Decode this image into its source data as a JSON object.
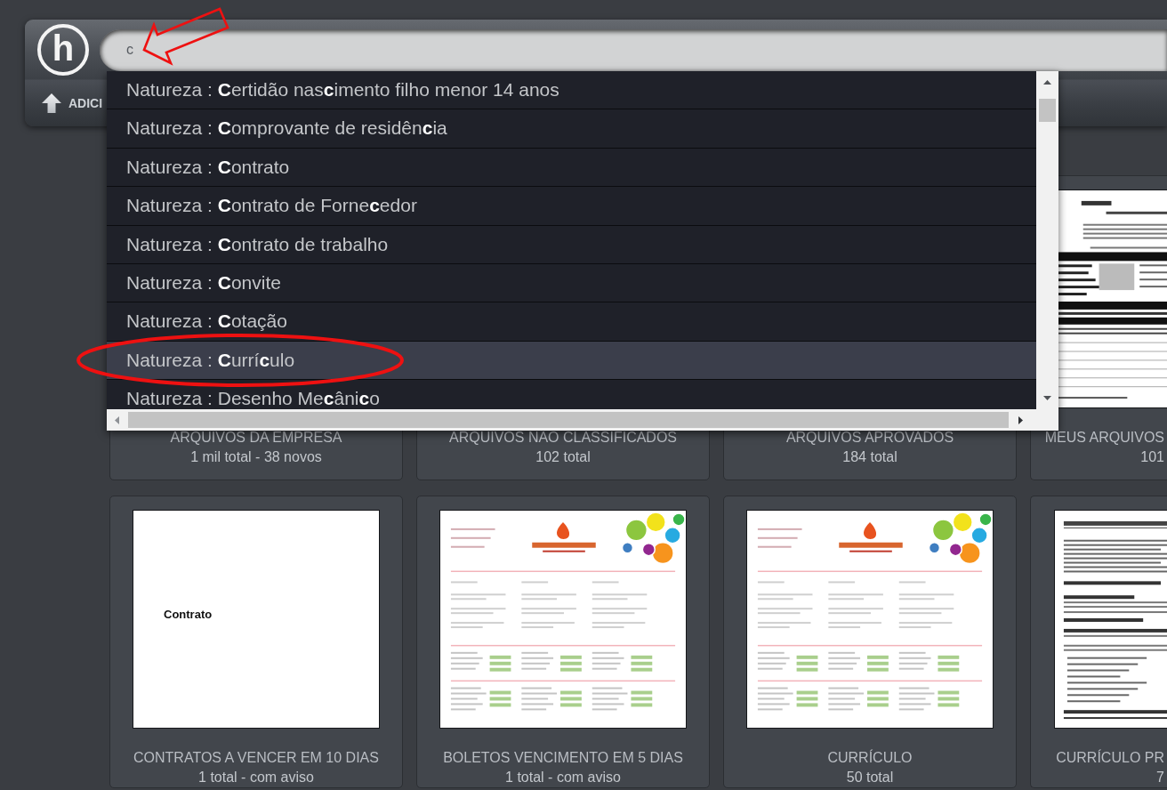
{
  "header": {
    "logo": {
      "text": "h"
    },
    "search": {
      "value": "c",
      "annotation": {
        "kind": "arrow"
      }
    },
    "toolbar": {
      "buttons": [
        {
          "label": "ADICI"
        }
      ]
    }
  },
  "suggestions": {
    "items": [
      {
        "text": "Natureza : **C**ertidão nas**c**imento filho menor 14 anos",
        "selected": false
      },
      {
        "text": "Natureza : **C**omprovante de residên**c**ia",
        "selected": false
      },
      {
        "text": "Natureza : **C**ontrato",
        "selected": false
      },
      {
        "text": "Natureza : **C**ontrato de Forne**c**edor",
        "selected": false
      },
      {
        "text": "Natureza : **C**ontrato de trabalho",
        "selected": false
      },
      {
        "text": "Natureza : **C**onvite",
        "selected": false
      },
      {
        "text": "Natureza : **C**otação",
        "selected": false
      },
      {
        "text": "Natureza : **C**urrí**c**ulo",
        "selected": true,
        "annotation": {
          "kind": "ellipse"
        }
      },
      {
        "text": "Natureza : Desenho Me**c**âni**c**o",
        "selected": false
      }
    ]
  },
  "tiles": [
    {
      "title": "ARQUIVOS DA EMPRESA",
      "subtitle": "1 mil total - 38 novos"
    },
    {
      "title": "ARQUIVOS NÃO CLASSIFICADOS",
      "subtitle": "102 total"
    },
    {
      "title": "ARQUIVOS APROVADOS",
      "subtitle": "184 total"
    },
    {
      "title": "MEUS ARQUIVOS",
      "subtitle": "101",
      "thumbnail": {
        "kind": "form"
      }
    },
    {
      "title": "CONTRATOS A VENCER EM 10 DIAS",
      "subtitle": "1 total - com aviso",
      "thumbnail": {
        "kind": "title",
        "text": "Contrato"
      }
    },
    {
      "title": "BOLETOS VENCIMENTO EM 5 DIAS",
      "subtitle": "1 total - com aviso",
      "thumbnail": {
        "kind": "brochure"
      }
    },
    {
      "title": "CURRÍCULO",
      "subtitle": "50 total",
      "thumbnail": {
        "kind": "brochure"
      }
    },
    {
      "title": "CURRÍCULO PR",
      "subtitle": "7",
      "thumbnail": {
        "kind": "letter"
      }
    }
  ]
}
